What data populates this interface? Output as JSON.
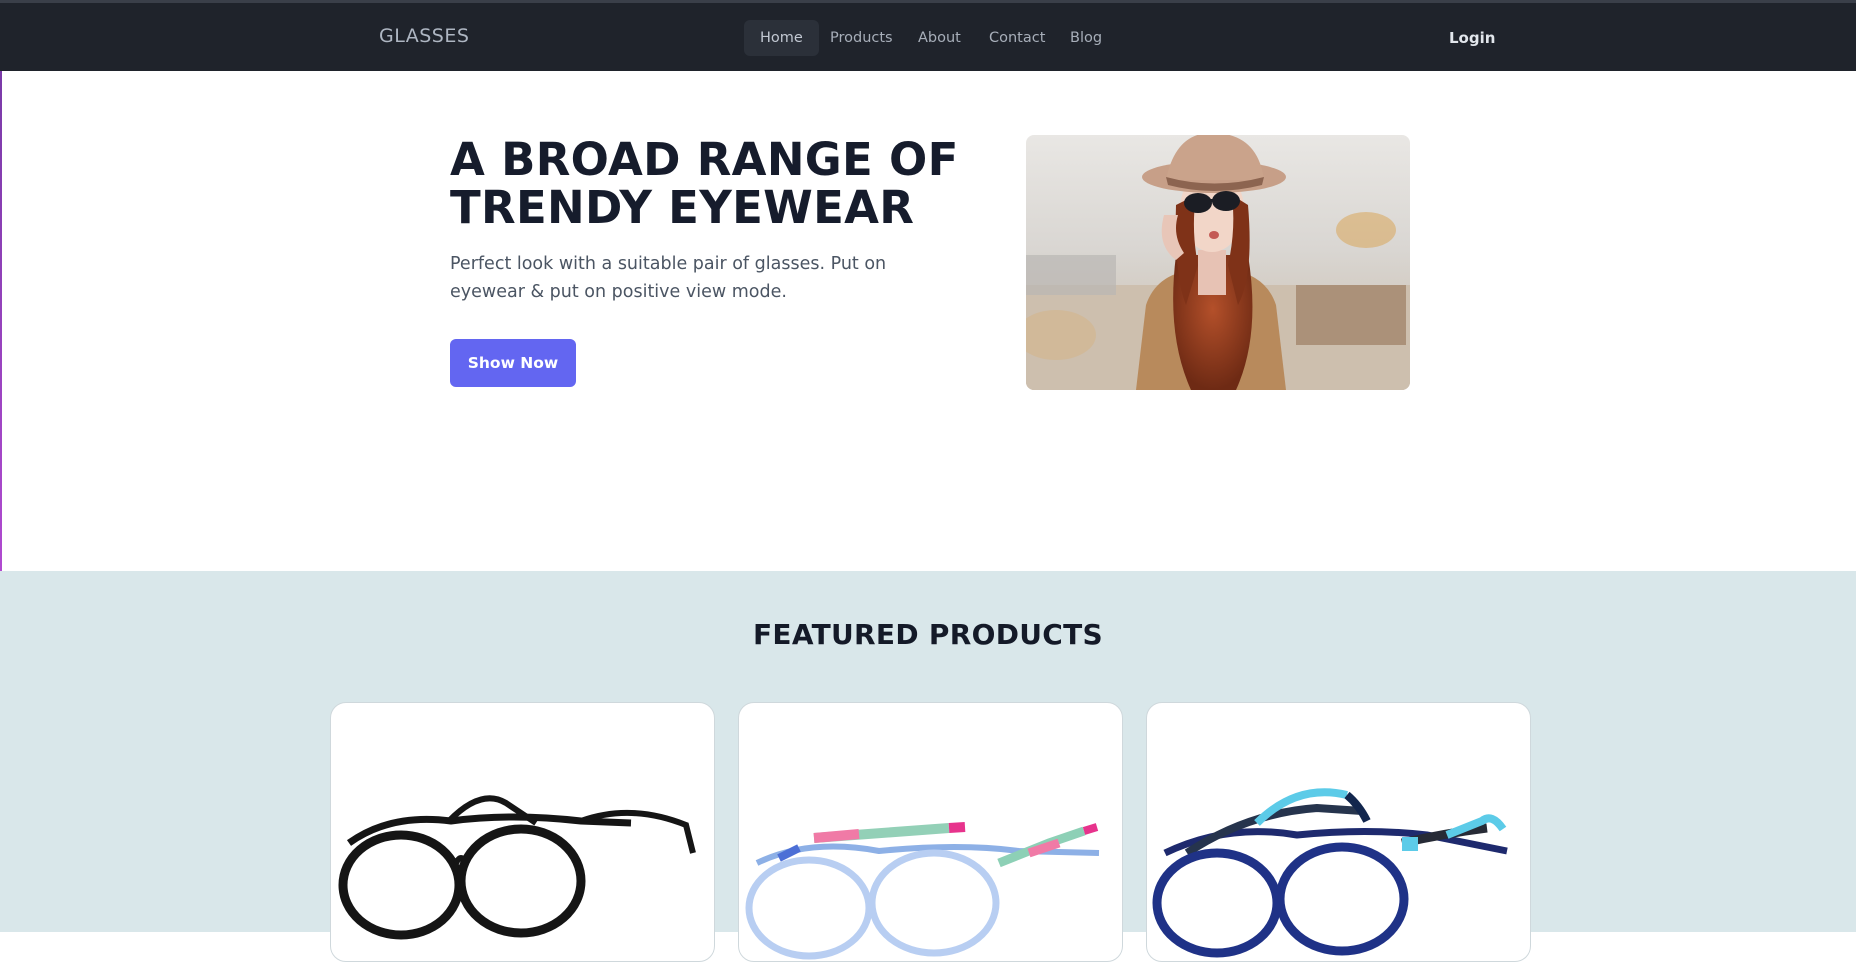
{
  "header": {
    "brand": "GLASSES",
    "nav": [
      {
        "label": "Home",
        "active": true
      },
      {
        "label": "Products",
        "active": false
      },
      {
        "label": "About",
        "active": false
      },
      {
        "label": "Contact",
        "active": false
      },
      {
        "label": "Blog",
        "active": false
      }
    ],
    "login_label": "Login"
  },
  "hero": {
    "title_line1": "A BROAD RANGE OF",
    "title_line2": "TRENDY EYEWEAR",
    "description": "Perfect look with a suitable pair of glasses. Put on eyewear & put on positive view mode.",
    "button_label": "Show Now",
    "image_icon": "woman-with-sunglasses-photo"
  },
  "featured": {
    "title": "FEATURED PRODUCTS",
    "products": [
      {
        "image_icon": "black-round-glasses-image"
      },
      {
        "image_icon": "clear-pastel-kids-glasses-image"
      },
      {
        "image_icon": "navy-blue-kids-glasses-image"
      }
    ]
  },
  "colors": {
    "header_bg": "#1f232b",
    "accent": "#6366f1",
    "featured_bg": "#d9e7ea",
    "title": "#161c2c"
  }
}
